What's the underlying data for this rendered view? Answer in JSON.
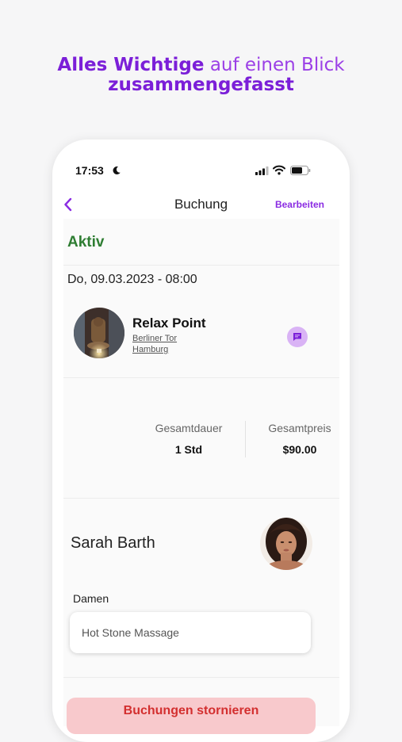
{
  "headline": {
    "bold_1": "Alles Wichtige",
    "light_1": "auf einen Blick",
    "bold_2": "zusammengefasst"
  },
  "status_bar": {
    "time": "17:53"
  },
  "nav": {
    "title": "Buchung",
    "edit_label": "Bearbeiten"
  },
  "booking": {
    "status": "Aktiv",
    "datetime": "Do, 09.03.2023 - 08:00",
    "venue": {
      "name": "Relax Point",
      "address_line1": "Berliner Tor",
      "address_line2": "Hamburg"
    },
    "duration_label": "Gesamtdauer",
    "duration_value": "1 Std",
    "price_label": "Gesamtpreis",
    "price_value": "$90.00",
    "therapist_name": "Sarah Barth",
    "category": "Damen",
    "service": "Hot Stone Massage",
    "cancel_label": "Buchungen stornieren"
  },
  "colors": {
    "accent": "#8a2be2",
    "status_green": "#2e7d32",
    "cancel_bg": "#f8c9cc",
    "cancel_text": "#d32f2f"
  },
  "icons": {
    "back": "chevron-left-icon",
    "chat": "chat-icon",
    "moon": "moon-icon",
    "signal": "signal-icon",
    "wifi": "wifi-icon",
    "battery": "battery-icon"
  }
}
